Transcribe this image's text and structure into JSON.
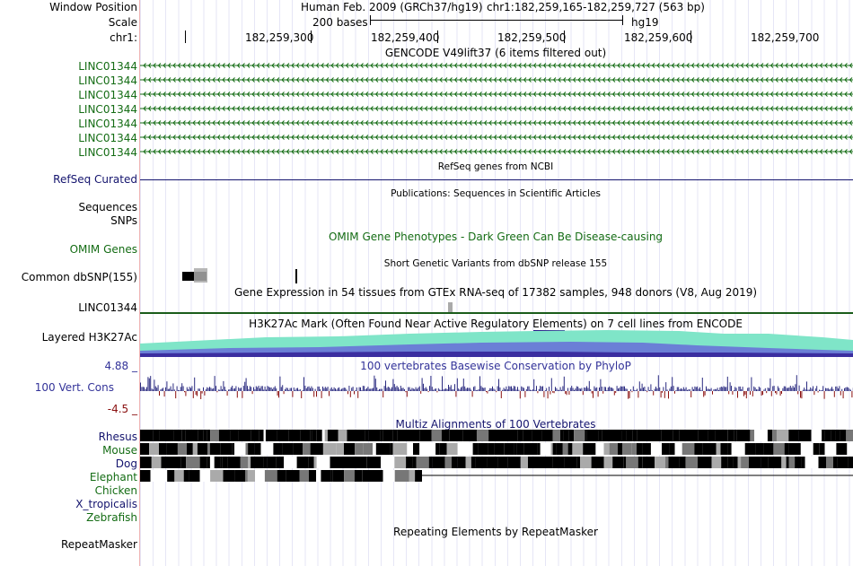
{
  "header": {
    "position_label": "Window Position",
    "scale_label": "Scale",
    "chrom_label": "chr1:",
    "assembly_text": "Human Feb. 2009 (GRCh37/hg19)",
    "coords_text": "chr1:182,259,165-182,259,727 (563 bp)",
    "scale_bases": "200 bases",
    "scale_db": "hg19",
    "ruler_ticks": [
      "182,259,300",
      "182,259,400",
      "182,259,500",
      "182,259,600",
      "182,259,700"
    ]
  },
  "gencode": {
    "title": "GENCODE V49lift37 (6 items filtered out)",
    "rows": [
      "LINC01344",
      "LINC01344",
      "LINC01344",
      "LINC01344",
      "LINC01344",
      "LINC01344",
      "LINC01344"
    ],
    "color": "#146c14"
  },
  "refseq": {
    "title": "RefSeq genes from NCBI",
    "label": "RefSeq Curated",
    "color": "#14146e"
  },
  "publications": {
    "title": "Publications: Sequences in Scientific Articles",
    "labels": [
      "Sequences",
      "SNPs"
    ]
  },
  "omim": {
    "title": "OMIM Gene Phenotypes - Dark Green Can Be Disease-causing",
    "label": "OMIM Genes",
    "color": "#146c14"
  },
  "dbsnp": {
    "title": "Short Genetic Variants from dbSNP release 155",
    "label": "Common dbSNP(155)"
  },
  "gtex": {
    "title": "Gene Expression in 54 tissues from GTEx RNA-seq of 17382 samples, 948 donors (V8, Aug 2019)",
    "label": "LINC01344",
    "color": "#1a5c1a"
  },
  "h3k27ac": {
    "title": "H3K27Ac Mark (Often Found Near Active Regulatory Elements) on 7 cell lines from ENCODE",
    "label": "Layered H3K27Ac",
    "colors": [
      "#7fe5c8",
      "#6b7fd6",
      "#3b2ea0"
    ]
  },
  "conservation": {
    "title": "100 vertebrates Basewise Conservation by PhyloP",
    "label": "100 Vert. Cons",
    "max_label": "4.88 _",
    "min_label": "-4.5 _",
    "pos_color": "#2a2a80",
    "neg_color": "#8a1010"
  },
  "multiz": {
    "title": "Multiz Alignments of 100 Vertebrates",
    "species": [
      "Rhesus",
      "Mouse",
      "Dog",
      "Elephant",
      "Chicken",
      "X_tropicalis",
      "Zebrafish"
    ],
    "species_colors": [
      "#14146e",
      "#146c14",
      "#14146e",
      "#146c14",
      "#146c14",
      "#14146e",
      "#146c14"
    ]
  },
  "repeatmasker": {
    "title": "Repeating Elements by RepeatMasker",
    "label": "RepeatMasker"
  }
}
